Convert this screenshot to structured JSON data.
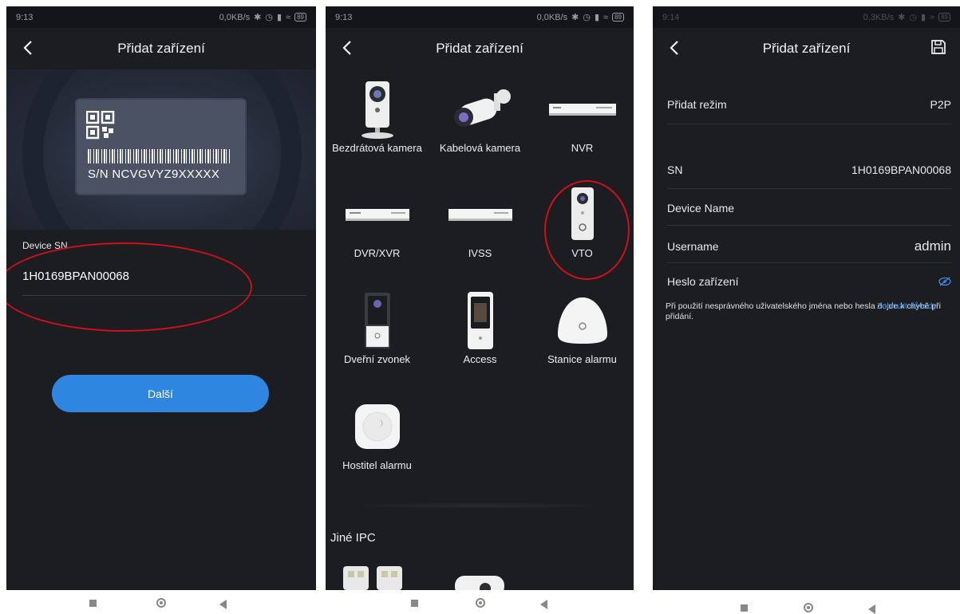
{
  "status_bar": {
    "p1": {
      "time": "9:13",
      "speed": "0,0KB/s",
      "battery": "89"
    },
    "p2": {
      "time": "9:13",
      "speed": "0,0KB/s",
      "battery": "89"
    },
    "p3": {
      "time": "9:14",
      "speed": "0,3KB/s",
      "battery": "89"
    }
  },
  "screen1": {
    "title": "Přidat zařízení",
    "label_sn": "S/N  NCVGVYZ9XXXXX",
    "field_label": "Device SN",
    "field_value": "1H0169BPAN00068",
    "next_button": "Další"
  },
  "screen2": {
    "title": "Přidat zařízení",
    "devices": [
      {
        "label": "Bezdrátová kamera",
        "icon": "wireless-camera-icon"
      },
      {
        "label": "Kabelová kamera",
        "icon": "bullet-camera-icon"
      },
      {
        "label": "NVR",
        "icon": "nvr-icon"
      },
      {
        "label": "DVR/XVR",
        "icon": "dvr-icon"
      },
      {
        "label": "IVSS",
        "icon": "ivss-icon"
      },
      {
        "label": "VTO",
        "icon": "vto-icon"
      },
      {
        "label": "Dveřní zvonek",
        "icon": "doorbell-icon"
      },
      {
        "label": "Access",
        "icon": "access-icon"
      },
      {
        "label": "Stanice alarmu",
        "icon": "alarm-station-icon"
      },
      {
        "label": "Hostitel alarmu",
        "icon": "alarm-host-icon"
      }
    ],
    "section_other": "Jiné IPC"
  },
  "screen3": {
    "title": "Přidat zařízení",
    "add_mode_label": "Přidat režim",
    "add_mode_value": "P2P",
    "sn_label": "SN",
    "sn_value": "1H0169BPAN00068",
    "device_name_label": "Device Name",
    "username_label": "Username",
    "username_value": "admin",
    "password_label": "Heslo zařízení",
    "warning_text": "Při použití nesprávného uživatelského jména nebo hesla dojde k chybě při přidání.",
    "warning_link": "Zobrazit důvody"
  },
  "colors": {
    "accent": "#2f86e0",
    "highlight": "#d10f1a",
    "background": "#1c1d21"
  }
}
